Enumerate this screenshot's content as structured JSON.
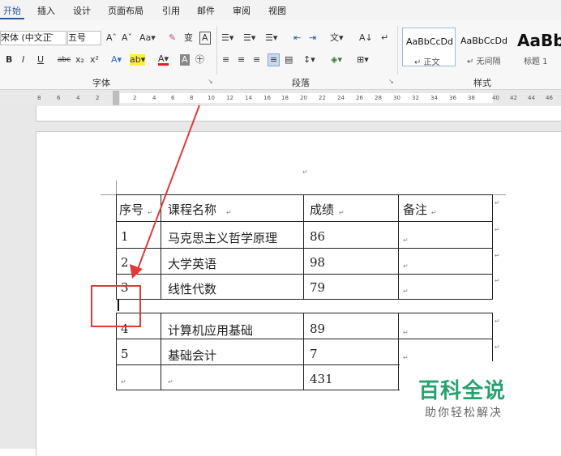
{
  "tabs": [
    "开始",
    "插入",
    "设计",
    "页面布局",
    "引用",
    "邮件",
    "审阅",
    "视图"
  ],
  "ribbon": {
    "font_name": "宋体 (中文正̄",
    "font_size": "五号",
    "row1_icons": [
      "Aˆ",
      "Aˇ",
      "Aa▾",
      "✎",
      "变",
      "A"
    ],
    "row2_icons": [
      "B",
      "I",
      "U",
      "abc",
      "x₂",
      "x²"
    ],
    "groups": {
      "font": "字体",
      "paragraph": "段落",
      "styles": "样式"
    },
    "styles": [
      {
        "sample": "AaBbCcDd",
        "name": "↵ 正文"
      },
      {
        "sample": "AaBbCcDd",
        "name": "↵ 无间隔"
      },
      {
        "sample": "AaBb",
        "name": "标题 1"
      }
    ]
  },
  "ruler": {
    "left_ticks": [
      "8",
      "6",
      "4",
      "2"
    ],
    "right_ticks": [
      "2",
      "4",
      "6",
      "8",
      "10",
      "12",
      "14",
      "16",
      "18",
      "20",
      "22",
      "24",
      "26",
      "28",
      "30",
      "32",
      "34",
      "36",
      "38",
      "40",
      "42",
      "44",
      "46"
    ]
  },
  "table": {
    "header": [
      "序号",
      "课程名称",
      "成绩",
      "备注"
    ],
    "rows": [
      [
        "1",
        "马克思主义哲学原理",
        "86",
        ""
      ],
      [
        "2",
        "大学英语",
        "98",
        ""
      ],
      [
        "3",
        "线性代数",
        "79",
        ""
      ],
      [
        "4",
        "计算机应用基础",
        "89",
        ""
      ],
      [
        "5",
        "基础会计",
        "7",
        ""
      ],
      [
        "",
        "",
        "431",
        ""
      ]
    ]
  },
  "annotation": {
    "arrow_color": "#e03a3a"
  },
  "watermark": {
    "title": "百科全说",
    "subtitle": "助你轻松解决"
  }
}
